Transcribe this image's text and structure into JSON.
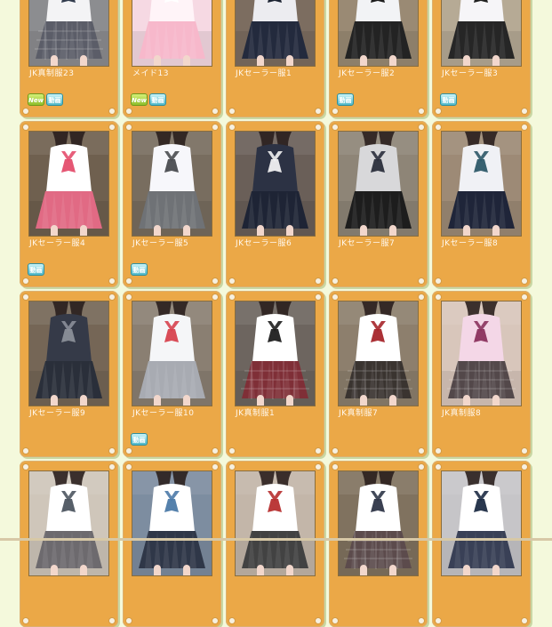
{
  "items": [
    {
      "title": "JK真制服23",
      "badges": [
        "New",
        "動画"
      ],
      "palette": {
        "bg": "#8c8d90",
        "top": "#f3f3f5",
        "skirt": "#5b5d68",
        "accent": "#273145"
      }
    },
    {
      "title": "メイド13",
      "badges": [
        "New",
        "動画"
      ],
      "palette": {
        "bg": "#f6d9e3",
        "top": "#fff4f8",
        "skirt": "#f7b8cb",
        "accent": "#ffffff"
      }
    },
    {
      "title": "JKセーラー服1",
      "badges": [],
      "palette": {
        "bg": "#7c6d60",
        "top": "#ececf0",
        "skirt": "#232a3d",
        "accent": "#111827"
      }
    },
    {
      "title": "JKセーラー服2",
      "badges": [
        "動画"
      ],
      "palette": {
        "bg": "#9a8a74",
        "top": "#f2f3f5",
        "skirt": "#232323",
        "accent": "#111111"
      }
    },
    {
      "title": "JKセーラー服3",
      "badges": [
        "動画"
      ],
      "palette": {
        "bg": "#b6aa95",
        "top": "#f6f5f8",
        "skirt": "#262626",
        "accent": "#141414"
      }
    },
    {
      "title": "JKセーラー服4",
      "badges": [
        "動画"
      ],
      "palette": {
        "bg": "#6f604f",
        "top": "#ffffff",
        "skirt": "#e16a84",
        "accent": "#e44e6d"
      }
    },
    {
      "title": "JKセーラー服5",
      "badges": [
        "動画"
      ],
      "palette": {
        "bg": "#786d5f",
        "top": "#f7f7fb",
        "skirt": "#6f7276",
        "accent": "#4a4c50"
      }
    },
    {
      "title": "JKセーラー服6",
      "badges": [],
      "palette": {
        "bg": "#6a5f58",
        "top": "#2c3244",
        "skirt": "#1e2435",
        "accent": "#f1f1f2"
      }
    },
    {
      "title": "JKセーラー服7",
      "badges": [],
      "palette": {
        "bg": "#8e8577",
        "top": "#d8d8da",
        "skirt": "#1d1d1d",
        "accent": "#2b2f3c"
      }
    },
    {
      "title": "JKセーラー服8",
      "badges": [],
      "palette": {
        "bg": "#9d8a76",
        "top": "#f0f1f5",
        "skirt": "#1f2539",
        "accent": "#2d5868"
      }
    },
    {
      "title": "JKセーラー服9",
      "badges": [],
      "palette": {
        "bg": "#756656",
        "top": "#353a48",
        "skirt": "#2a2f3a",
        "accent": "#8b8f99"
      }
    },
    {
      "title": "JKセーラー服10",
      "badges": [
        "動画"
      ],
      "palette": {
        "bg": "#8a7f72",
        "top": "#f5f6f8",
        "skirt": "#a8abb2",
        "accent": "#d7424e"
      }
    },
    {
      "title": "JK真制服1",
      "badges": [],
      "palette": {
        "bg": "#6d655f",
        "top": "#ffffff",
        "skirt": "#7f2f37",
        "accent": "#1f1f1f"
      }
    },
    {
      "title": "JK真制服7",
      "badges": [],
      "palette": {
        "bg": "#8d7f6d",
        "top": "#ffffff",
        "skirt": "#3a3430",
        "accent": "#a6262b"
      }
    },
    {
      "title": "JK真制服8",
      "badges": [],
      "palette": {
        "bg": "#d8c6bb",
        "top": "#f4d7e7",
        "skirt": "#53484a",
        "accent": "#8b335e"
      }
    },
    {
      "title": "",
      "badges": [],
      "palette": {
        "bg": "#cfc6ba",
        "top": "#ffffff",
        "skirt": "#6d6a6e",
        "accent": "#4e5661"
      }
    },
    {
      "title": "",
      "badges": [],
      "palette": {
        "bg": "#7d8da0",
        "top": "#ffffff",
        "skirt": "#2f3748",
        "accent": "#4c7aa8"
      }
    },
    {
      "title": "",
      "badges": [],
      "palette": {
        "bg": "#c3b6a9",
        "top": "#ffffff",
        "skirt": "#424242",
        "accent": "#b72f2f"
      }
    },
    {
      "title": "",
      "badges": [],
      "palette": {
        "bg": "#80725f",
        "top": "#ffffff",
        "skirt": "#5c4b4c",
        "accent": "#2f3648"
      }
    },
    {
      "title": "",
      "badges": [],
      "palette": {
        "bg": "#c6c5c8",
        "top": "#ffffff",
        "skirt": "#394056",
        "accent": "#1e2c45"
      }
    }
  ]
}
